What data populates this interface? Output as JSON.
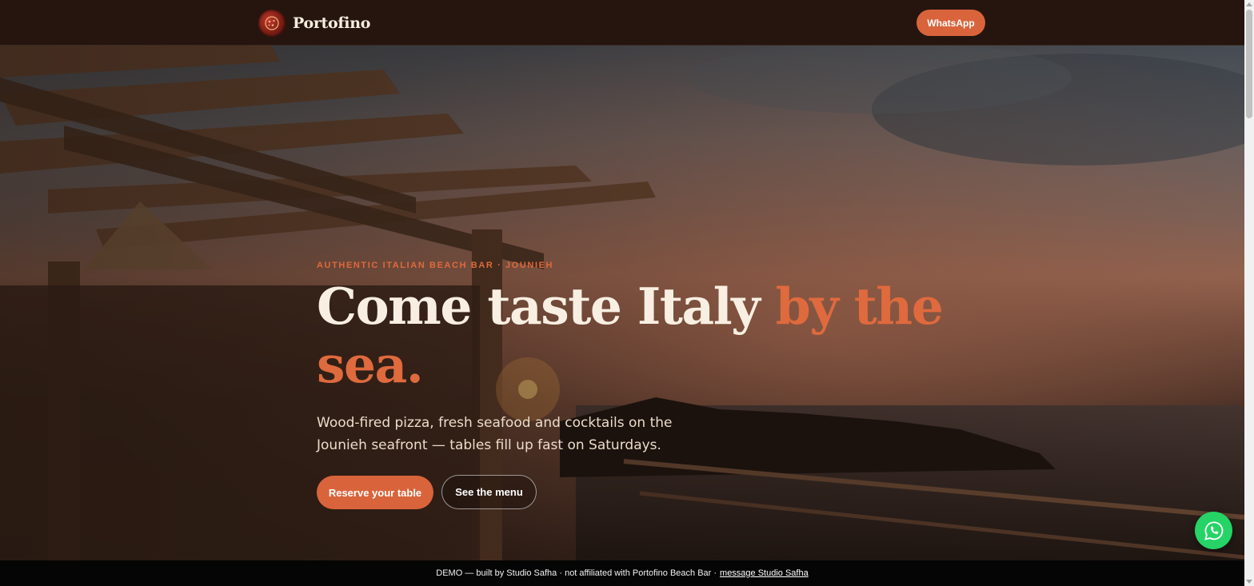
{
  "nav": {
    "brand_name": "Portofino",
    "cta_label": "WhatsApp",
    "logo_icon": "pizza-logo-icon"
  },
  "hero": {
    "eyebrow": "AUTHENTIC ITALIAN BEACH BAR · JOUNIEH",
    "headline_main": "Come taste Italy ",
    "headline_accent": "by the sea.",
    "subtext": "Wood-fired pizza, fresh seafood and cocktails on the Jounieh seafront — tables fill up fast on Saturdays.",
    "primary_cta": "Reserve your table",
    "secondary_cta": "See the menu",
    "background": "pergola-sunset-sea-photo"
  },
  "floating": {
    "whatsapp_icon": "whatsapp-icon"
  },
  "demo_bar": {
    "text": "DEMO — built by Studio Safha · not affiliated with Portofino Beach Bar ·",
    "link": "message Studio Safha"
  },
  "colors": {
    "accent": "#d9643b",
    "nav_bg": "#25150e",
    "headline": "#f8efe2",
    "whatsapp": "#25d366"
  }
}
